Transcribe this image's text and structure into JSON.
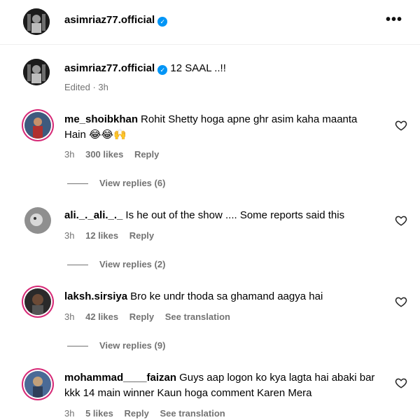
{
  "header": {
    "username": "asimriaz77.official"
  },
  "caption": {
    "username": "asimriaz77.official",
    "text": "12 SAAL ..!!",
    "meta": "Edited · 3h"
  },
  "comments": [
    {
      "username": "me_shoibkhan",
      "text": "Rohit Shetty hoga apne ghr asim kaha maanta Hain 😂😂🙌",
      "time": "3h",
      "likes": "300 likes",
      "reply": "Reply",
      "view_replies": "View replies (6)"
    },
    {
      "username": "ali._._ali._._",
      "text": "Is he out of the show .... Some reports said this",
      "time": "3h",
      "likes": "12 likes",
      "reply": "Reply",
      "view_replies": "View replies (2)"
    },
    {
      "username": "laksh.sirsiya",
      "text": "Bro ke undr thoda sa ghamand aagya hai",
      "time": "3h",
      "likes": "42 likes",
      "reply": "Reply",
      "translation": "See translation",
      "view_replies": "View replies (9)"
    },
    {
      "username": "mohammad____faizan",
      "text": "Guys aap logon ko kya lagta hai abaki bar kkk 14 main winner Kaun hoga comment Karen Mera",
      "time": "3h",
      "likes": "5 likes",
      "reply": "Reply",
      "translation": "See translation"
    }
  ],
  "colors": {
    "verified": "#0095f6",
    "secondary_text": "#737373",
    "story_ring": "#d62976"
  },
  "icons": {
    "more": "more-options-icon",
    "like": "heart-icon",
    "verified": "verified-badge-icon"
  }
}
